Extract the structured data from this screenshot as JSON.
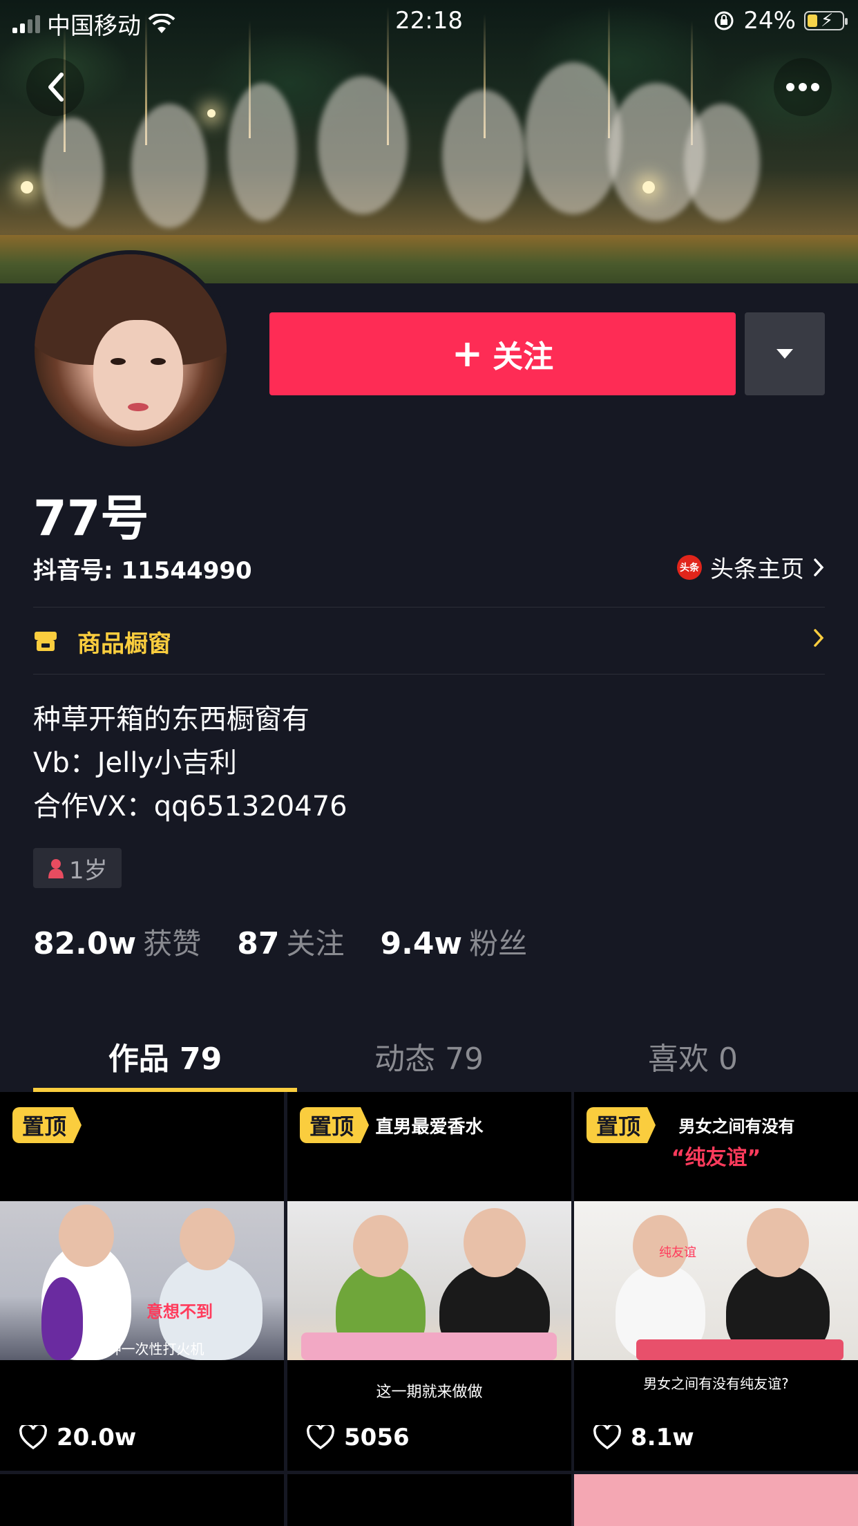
{
  "status_bar": {
    "carrier": "中国移动",
    "time": "22:18",
    "battery_percent": "24%"
  },
  "header": {
    "back_icon": "chevron-left-icon",
    "more_icon": "more-dots-icon"
  },
  "actions": {
    "follow_label": "关注",
    "follow_icon": "plus-icon",
    "dropdown_icon": "triangle-down-icon"
  },
  "profile": {
    "name": "77号",
    "douyin_id": "抖音号: 11544990",
    "toutiao_badge": "头条",
    "toutiao_label": "头条主页",
    "shop_label": "商品橱窗",
    "bio_lines": [
      "种草开箱的东西橱窗有",
      "Vb：Jelly小吉利",
      "合作VX：qq651320476"
    ],
    "age_tag": "1岁"
  },
  "stats": [
    {
      "num": "82.0w",
      "label": "获赞"
    },
    {
      "num": "87",
      "label": "关注"
    },
    {
      "num": "9.4w",
      "label": "粉丝"
    }
  ],
  "tabs": [
    {
      "label": "作品 79",
      "active": true
    },
    {
      "label": "动态 79",
      "active": false
    },
    {
      "label": "喜欢 0",
      "active": false
    }
  ],
  "videos": [
    {
      "pin": "置顶",
      "title": "",
      "caption_top": "意想不到",
      "caption_bottom": "就帮种一次性打火机",
      "bottom_text": "",
      "likes": "20.0w"
    },
    {
      "pin": "置顶",
      "title": "直男最爱香水",
      "caption_top": "",
      "caption_bottom": "",
      "bottom_text": "这一期就来做做",
      "likes": "5056"
    },
    {
      "pin": "置顶",
      "title": "男女之间有没有",
      "subtitle": "“纯友谊”",
      "caption_top": "纯友谊",
      "caption_bottom": "",
      "bottom_text": "男女之间有没有纯友谊?",
      "likes": "8.1w"
    }
  ],
  "colors": {
    "background": "#161823",
    "follow": "#fe2c55",
    "accent_yellow": "#facd3e"
  }
}
